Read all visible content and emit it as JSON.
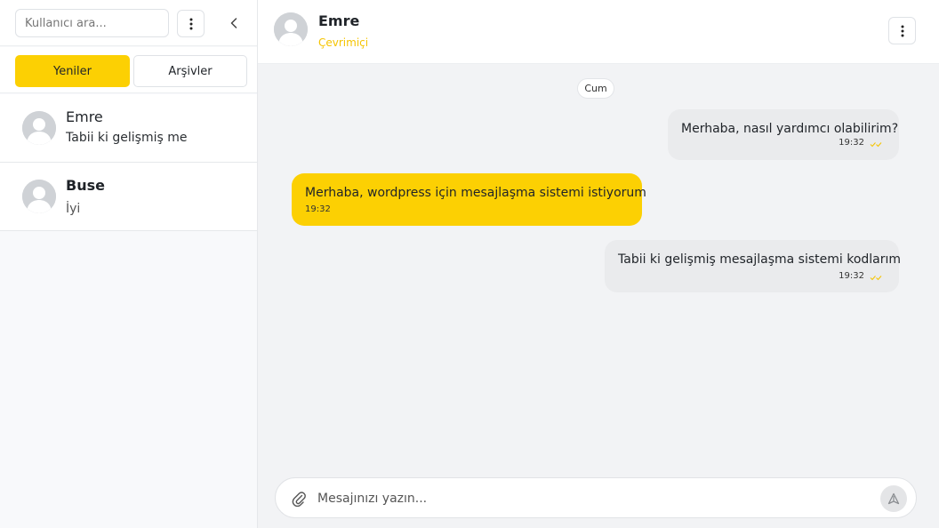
{
  "sidebar": {
    "search": {
      "placeholder": "Kullanıcı ara..."
    },
    "tabs": [
      {
        "label": "Yeniler",
        "active": true
      },
      {
        "label": "Arşivler",
        "active": false
      }
    ],
    "conversations": [
      {
        "name": "Emre",
        "last_message": "Tabii ki gelişmiş me"
      },
      {
        "name": "Buse",
        "last_message": "İyi"
      }
    ]
  },
  "chat": {
    "peer": {
      "name": "Emre",
      "status": "Çevrimiçi"
    },
    "day_label": "Cum",
    "messages": [
      {
        "direction": "outgoing",
        "text": "Merhaba, nasıl yardımcı olabilirim?",
        "time": "19:32",
        "status_icon": "double-check-icon"
      },
      {
        "direction": "incoming",
        "text": "Merhaba, wordpress için mesajlaşma sistemi istiyorum",
        "time": "19:32"
      },
      {
        "direction": "outgoing",
        "text": "Tabii ki gelişmiş mesajlaşma sistemi kodlarım",
        "time": "19:32",
        "status_icon": "double-check-icon"
      }
    ],
    "composer": {
      "placeholder": "Mesajınızı yazın...",
      "value": ""
    }
  },
  "colors": {
    "accent": "#fcd003",
    "status_online": "#f5c400",
    "outgoing_bubble": "#eaebed",
    "chat_background": "#f2f3f5"
  },
  "icons": {
    "sidebar_menu": "vertical-dots-icon",
    "collapse": "chevron-left-icon",
    "chat_menu": "vertical-dots-icon",
    "attach": "paperclip-icon",
    "send": "send-icon",
    "avatar": "default-user-avatar"
  }
}
